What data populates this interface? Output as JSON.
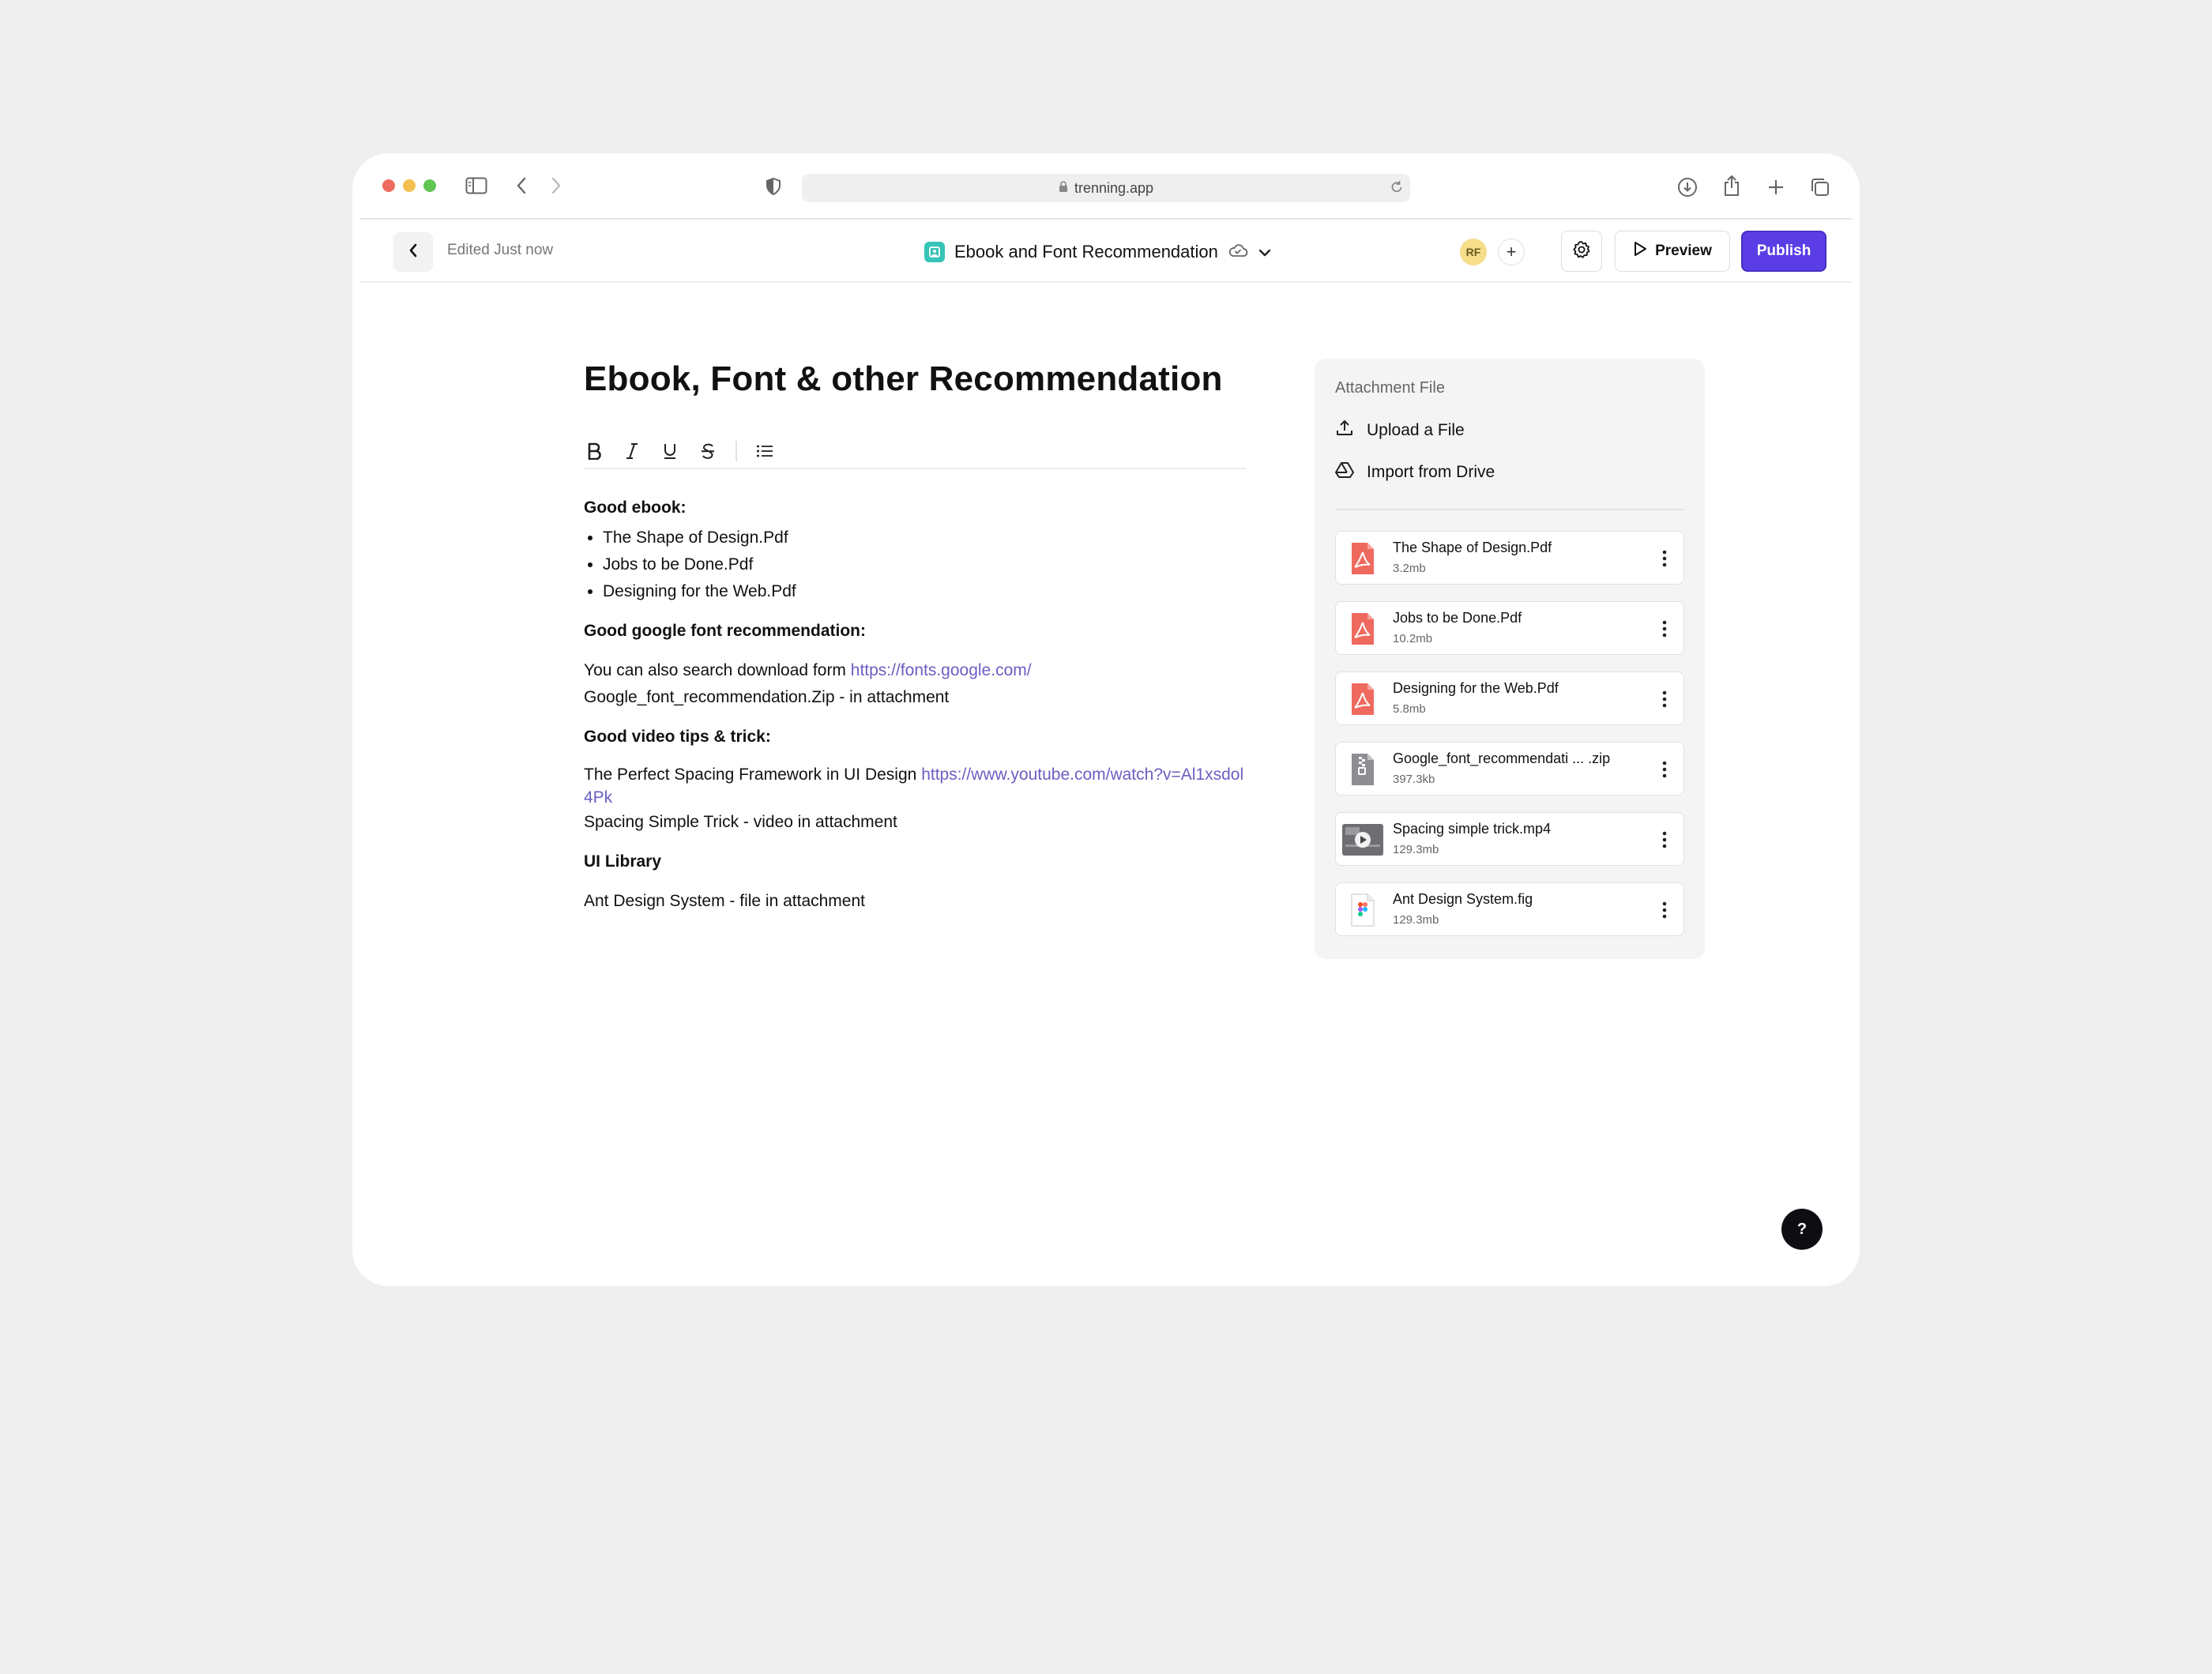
{
  "browser": {
    "url": "trenning.app",
    "traffic_lights": [
      "#ed6a5e",
      "#f5bf4f",
      "#61c554"
    ]
  },
  "header": {
    "edited_status": "Edited Just now",
    "doc_title": "Ebook and Font Recommendation",
    "avatar_initials": "RF",
    "add_collaborator": "+",
    "preview_label": "Preview",
    "publish_label": "Publish",
    "accent_color": "#5b3de6"
  },
  "editor": {
    "title": "Ebook, Font & other Recommendation",
    "toolbar": [
      "bold-icon",
      "italic-icon",
      "underline-icon",
      "strikethrough-icon",
      "bullet-list-icon"
    ],
    "ebook_heading": "Good ebook:",
    "ebooks": [
      "The Shape of Design.Pdf",
      "Jobs to be Done.Pdf",
      "Designing for the Web.Pdf"
    ],
    "font_heading": "Good google font recommendation:",
    "font_text": "You can also search download form",
    "font_link": "https://fonts.google.com/",
    "font_zip": "Google_font_recommendation.Zip - in attachment",
    "video_heading": "Good video tips & trick:",
    "video_text": "The Perfect Spacing Framework in UI Design",
    "video_link": "https://www.youtube.com/watch?v=Al1xsdol4Pk",
    "video_attachment": "Spacing Simple Trick - video in attachment",
    "ui_heading": "UI Library",
    "ui_text": "Ant Design System - file in attachment"
  },
  "attachments": {
    "title": "Attachment File",
    "upload_label": "Upload a File",
    "drive_label": "Import from Drive",
    "files": [
      {
        "name": "The Shape of Design.Pdf",
        "size": "3.2mb",
        "type": "pdf"
      },
      {
        "name": "Jobs to be Done.Pdf",
        "size": "10.2mb",
        "type": "pdf"
      },
      {
        "name": "Designing for the Web.Pdf",
        "size": "5.8mb",
        "type": "pdf"
      },
      {
        "name": "Google_font_recommendati ... .zip",
        "size": "397.3kb",
        "type": "zip"
      },
      {
        "name": "Spacing simple trick.mp4",
        "size": "129.3mb",
        "type": "video"
      },
      {
        "name": "Ant Design System.fig",
        "size": "129.3mb",
        "type": "figma"
      }
    ]
  },
  "help": {
    "label": "?"
  }
}
